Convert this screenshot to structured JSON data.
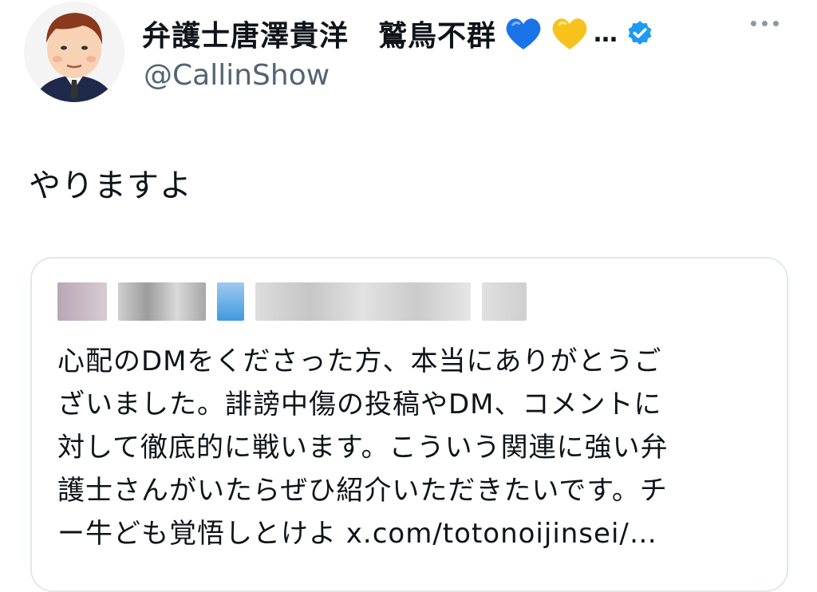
{
  "author": {
    "display_name": "弁護士唐澤貴洋　鷲鳥不群",
    "ellipsis": "…",
    "handle": "@CallinShow"
  },
  "tweet": {
    "text": "やりますよ"
  },
  "quoted_tweet": {
    "text_lines": [
      "心配のDMをくださった方、本当にありがとうご",
      "ざいました。誹謗中傷の投稿やDM、コメントに",
      "対して徹底的に戦います。こういう関連に強い弁",
      "護士さんがいたらぜひ紹介いただきたいです。チ",
      "ー牛ども覚悟しとけよ x.com/totonoijinsei/…"
    ]
  },
  "colors": {
    "text": "#0f1419",
    "secondary": "#536471",
    "verified": "#1d9bf0",
    "border": "#e1e8ed"
  },
  "icons": [
    "blue-heart-icon",
    "yellow-heart-icon",
    "verified-badge-icon",
    "more-options-icon"
  ]
}
